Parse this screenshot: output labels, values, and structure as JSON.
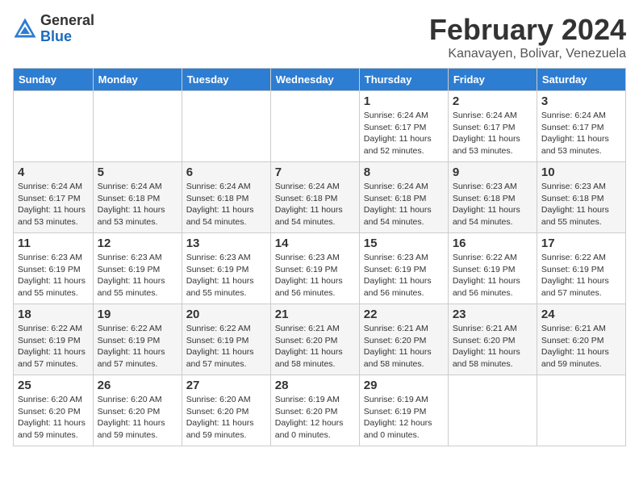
{
  "header": {
    "logo_general": "General",
    "logo_blue": "Blue",
    "month_year": "February 2024",
    "location": "Kanavayen, Bolivar, Venezuela"
  },
  "days_of_week": [
    "Sunday",
    "Monday",
    "Tuesday",
    "Wednesday",
    "Thursday",
    "Friday",
    "Saturday"
  ],
  "weeks": [
    [
      {
        "day": "",
        "info": ""
      },
      {
        "day": "",
        "info": ""
      },
      {
        "day": "",
        "info": ""
      },
      {
        "day": "",
        "info": ""
      },
      {
        "day": "1",
        "info": "Sunrise: 6:24 AM\nSunset: 6:17 PM\nDaylight: 11 hours\nand 52 minutes."
      },
      {
        "day": "2",
        "info": "Sunrise: 6:24 AM\nSunset: 6:17 PM\nDaylight: 11 hours\nand 53 minutes."
      },
      {
        "day": "3",
        "info": "Sunrise: 6:24 AM\nSunset: 6:17 PM\nDaylight: 11 hours\nand 53 minutes."
      }
    ],
    [
      {
        "day": "4",
        "info": "Sunrise: 6:24 AM\nSunset: 6:17 PM\nDaylight: 11 hours\nand 53 minutes."
      },
      {
        "day": "5",
        "info": "Sunrise: 6:24 AM\nSunset: 6:18 PM\nDaylight: 11 hours\nand 53 minutes."
      },
      {
        "day": "6",
        "info": "Sunrise: 6:24 AM\nSunset: 6:18 PM\nDaylight: 11 hours\nand 54 minutes."
      },
      {
        "day": "7",
        "info": "Sunrise: 6:24 AM\nSunset: 6:18 PM\nDaylight: 11 hours\nand 54 minutes."
      },
      {
        "day": "8",
        "info": "Sunrise: 6:24 AM\nSunset: 6:18 PM\nDaylight: 11 hours\nand 54 minutes."
      },
      {
        "day": "9",
        "info": "Sunrise: 6:23 AM\nSunset: 6:18 PM\nDaylight: 11 hours\nand 54 minutes."
      },
      {
        "day": "10",
        "info": "Sunrise: 6:23 AM\nSunset: 6:18 PM\nDaylight: 11 hours\nand 55 minutes."
      }
    ],
    [
      {
        "day": "11",
        "info": "Sunrise: 6:23 AM\nSunset: 6:19 PM\nDaylight: 11 hours\nand 55 minutes."
      },
      {
        "day": "12",
        "info": "Sunrise: 6:23 AM\nSunset: 6:19 PM\nDaylight: 11 hours\nand 55 minutes."
      },
      {
        "day": "13",
        "info": "Sunrise: 6:23 AM\nSunset: 6:19 PM\nDaylight: 11 hours\nand 55 minutes."
      },
      {
        "day": "14",
        "info": "Sunrise: 6:23 AM\nSunset: 6:19 PM\nDaylight: 11 hours\nand 56 minutes."
      },
      {
        "day": "15",
        "info": "Sunrise: 6:23 AM\nSunset: 6:19 PM\nDaylight: 11 hours\nand 56 minutes."
      },
      {
        "day": "16",
        "info": "Sunrise: 6:22 AM\nSunset: 6:19 PM\nDaylight: 11 hours\nand 56 minutes."
      },
      {
        "day": "17",
        "info": "Sunrise: 6:22 AM\nSunset: 6:19 PM\nDaylight: 11 hours\nand 57 minutes."
      }
    ],
    [
      {
        "day": "18",
        "info": "Sunrise: 6:22 AM\nSunset: 6:19 PM\nDaylight: 11 hours\nand 57 minutes."
      },
      {
        "day": "19",
        "info": "Sunrise: 6:22 AM\nSunset: 6:19 PM\nDaylight: 11 hours\nand 57 minutes."
      },
      {
        "day": "20",
        "info": "Sunrise: 6:22 AM\nSunset: 6:19 PM\nDaylight: 11 hours\nand 57 minutes."
      },
      {
        "day": "21",
        "info": "Sunrise: 6:21 AM\nSunset: 6:20 PM\nDaylight: 11 hours\nand 58 minutes."
      },
      {
        "day": "22",
        "info": "Sunrise: 6:21 AM\nSunset: 6:20 PM\nDaylight: 11 hours\nand 58 minutes."
      },
      {
        "day": "23",
        "info": "Sunrise: 6:21 AM\nSunset: 6:20 PM\nDaylight: 11 hours\nand 58 minutes."
      },
      {
        "day": "24",
        "info": "Sunrise: 6:21 AM\nSunset: 6:20 PM\nDaylight: 11 hours\nand 59 minutes."
      }
    ],
    [
      {
        "day": "25",
        "info": "Sunrise: 6:20 AM\nSunset: 6:20 PM\nDaylight: 11 hours\nand 59 minutes."
      },
      {
        "day": "26",
        "info": "Sunrise: 6:20 AM\nSunset: 6:20 PM\nDaylight: 11 hours\nand 59 minutes."
      },
      {
        "day": "27",
        "info": "Sunrise: 6:20 AM\nSunset: 6:20 PM\nDaylight: 11 hours\nand 59 minutes."
      },
      {
        "day": "28",
        "info": "Sunrise: 6:19 AM\nSunset: 6:20 PM\nDaylight: 12 hours\nand 0 minutes."
      },
      {
        "day": "29",
        "info": "Sunrise: 6:19 AM\nSunset: 6:19 PM\nDaylight: 12 hours\nand 0 minutes."
      },
      {
        "day": "",
        "info": ""
      },
      {
        "day": "",
        "info": ""
      }
    ]
  ]
}
